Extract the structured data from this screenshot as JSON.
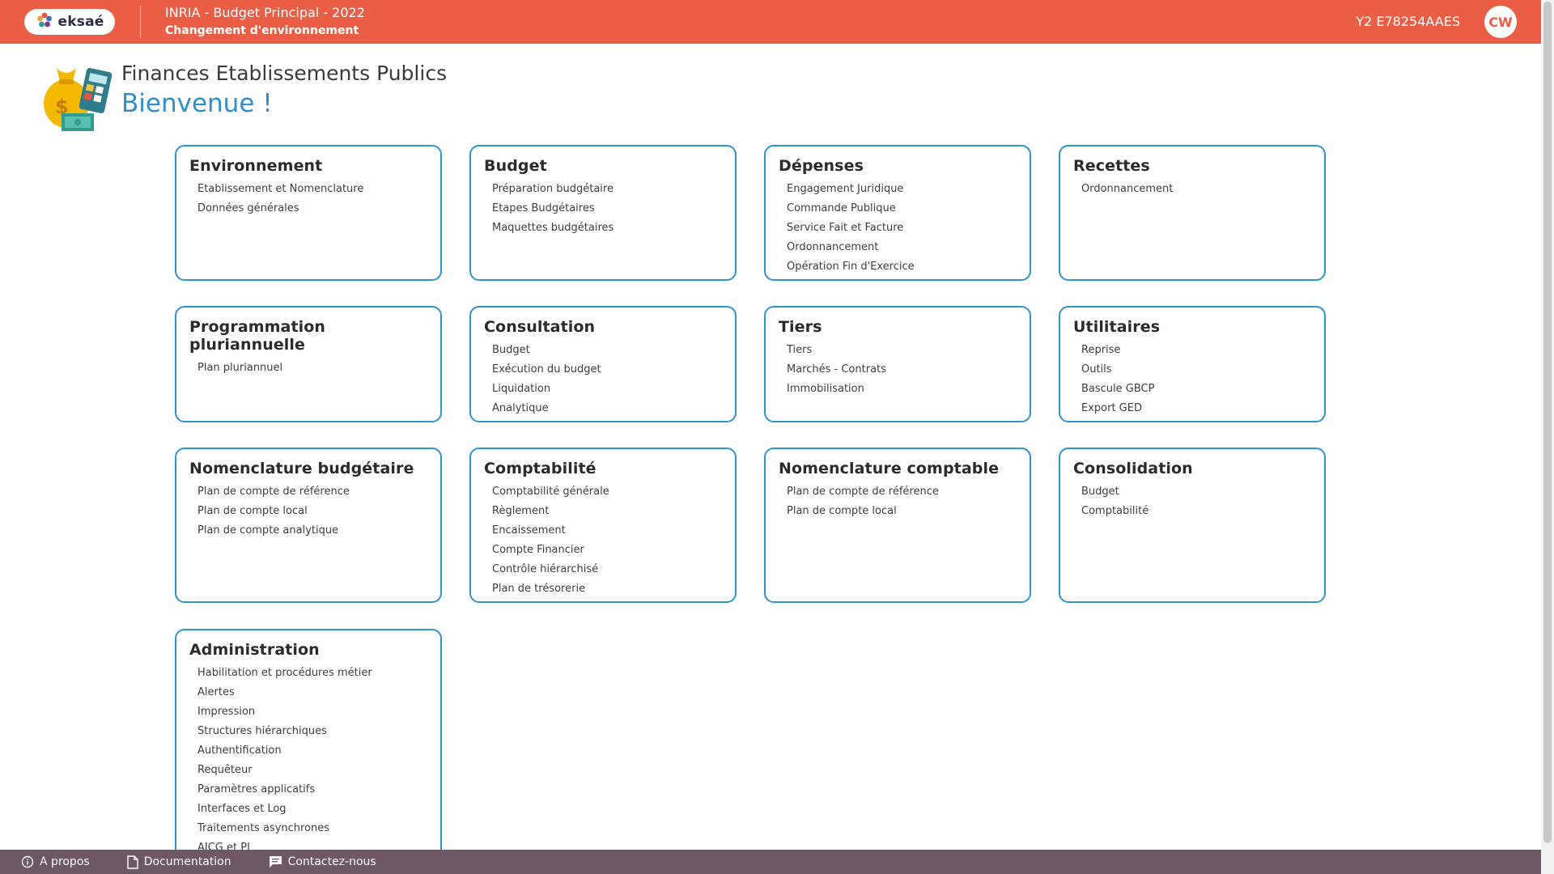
{
  "header": {
    "logo_text": "eksaé",
    "env_title": "INRIA - Budget Principal - 2022",
    "env_link": "Changement d'environnement",
    "env_code": "Y2 E78254AAES",
    "avatar_initials": "CW"
  },
  "welcome": {
    "app_title": "Finances Etablissements Publics",
    "greeting": "Bienvenue !"
  },
  "colors": {
    "header_bg": "#ea5e45",
    "card_border": "#2e94cd",
    "footer_bg": "#6e5767",
    "welcome_text": "#2f8fcc"
  },
  "cards": [
    {
      "title": "Environnement",
      "links": [
        "Etablissement et Nomenclature",
        "Données générales"
      ]
    },
    {
      "title": "Budget",
      "links": [
        "Préparation budgétaire",
        "Etapes Budgétaires",
        "Maquettes budgétaires"
      ]
    },
    {
      "title": "Dépenses",
      "links": [
        "Engagement Juridique",
        "Commande Publique",
        "Service Fait et Facture",
        "Ordonnancement",
        "Opération Fin d'Exercice"
      ]
    },
    {
      "title": "Recettes",
      "links": [
        "Ordonnancement"
      ]
    },
    {
      "title": "Programmation pluriannuelle",
      "links": [
        "Plan pluriannuel"
      ]
    },
    {
      "title": "Consultation",
      "links": [
        "Budget",
        "Exécution du budget",
        "Liquidation",
        "Analytique"
      ]
    },
    {
      "title": "Tiers",
      "links": [
        "Tiers",
        "Marchés - Contrats",
        "Immobilisation"
      ]
    },
    {
      "title": "Utilitaires",
      "links": [
        "Reprise",
        "Outils",
        "Bascule GBCP",
        "Export GED"
      ]
    },
    {
      "title": "Nomenclature budgétaire",
      "links": [
        "Plan de compte de référence",
        "Plan de compte local",
        "Plan de compte analytique"
      ]
    },
    {
      "title": "Comptabilité",
      "links": [
        "Comptabilité générale",
        "Règlement",
        "Encaissement",
        "Compte Financier",
        "Contrôle hiérarchisé",
        "Plan de trésorerie"
      ]
    },
    {
      "title": "Nomenclature comptable",
      "links": [
        "Plan de compte de référence",
        "Plan de compte local"
      ]
    },
    {
      "title": "Consolidation",
      "links": [
        "Budget",
        "Comptabilité"
      ]
    },
    {
      "title": "Administration",
      "links": [
        "Habilitation et procédures métier",
        "Alertes",
        "Impression",
        "Structures hiérarchiques",
        "Authentification",
        "Requêteur",
        "Paramètres applicatifs",
        "Interfaces et Log",
        "Traitements asynchrones",
        "AICG et PJ"
      ]
    }
  ],
  "footer": {
    "about": "A propos",
    "documentation": "Documentation",
    "contact": "Contactez-nous"
  }
}
